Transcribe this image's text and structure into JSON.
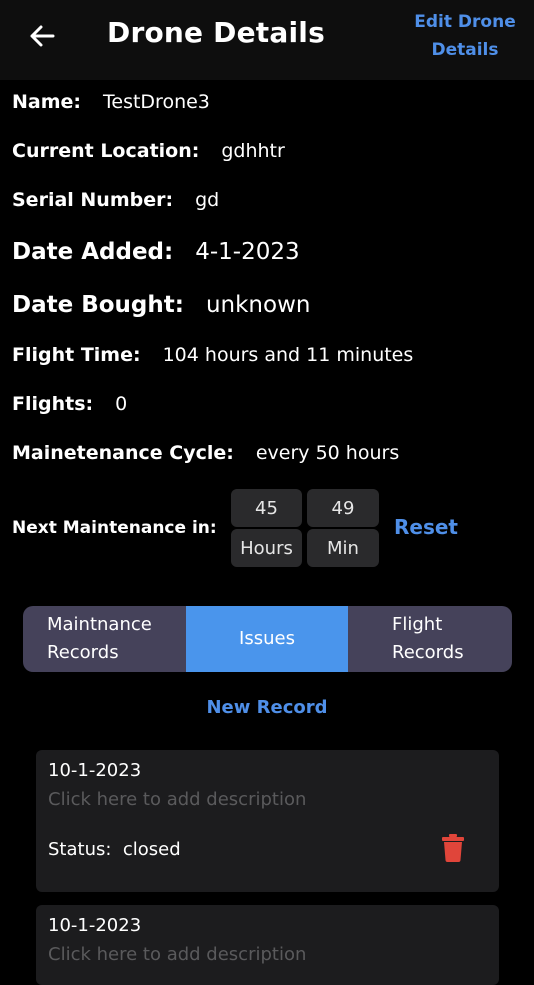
{
  "header": {
    "title": "Drone Details",
    "edit_label_line1": "Edit Drone",
    "edit_label_line2": "Details"
  },
  "details": {
    "name_label": "Name:",
    "name_value": "TestDrone3",
    "location_label": "Current Location:",
    "location_value": "gdhhtr",
    "serial_label": "Serial Number:",
    "serial_value": "gd",
    "added_label": "Date Added:",
    "added_value": "4-1-2023",
    "bought_label": "Date Bought:",
    "bought_value": "unknown",
    "flight_time_label": "Flight Time:",
    "flight_time_value": "104 hours and 11 minutes",
    "flights_label": "Flights:",
    "flights_value": "0",
    "cycle_label": "Mainetenance Cycle:",
    "cycle_value": "every 50 hours"
  },
  "next_maintenance": {
    "label": "Next Maintenance in:",
    "hours_value": "45",
    "hours_unit": "Hours",
    "minutes_value": "49",
    "minutes_unit": "Min",
    "reset_label": "Reset"
  },
  "tabs": [
    {
      "line1": "Maintnance",
      "line2": "Records"
    },
    {
      "line1": "Issues"
    },
    {
      "line1": "Flight",
      "line2": "Records"
    }
  ],
  "active_tab": "Issues",
  "new_record_label": "New Record",
  "records": [
    {
      "date": "10-1-2023",
      "description_placeholder": "Click here to add description",
      "status_label": "Status:",
      "status_value": "closed"
    },
    {
      "date": "10-1-2023",
      "description_placeholder": "Click here to add description"
    }
  ],
  "colors": {
    "accent": "#4f8fe8",
    "active_tab": "#4a95ec",
    "tab_bg": "#45425a",
    "delete": "#e0453a",
    "card_bg": "#1c1c1e"
  },
  "icons": {
    "back": "arrow-left-icon",
    "delete": "trash-icon"
  }
}
